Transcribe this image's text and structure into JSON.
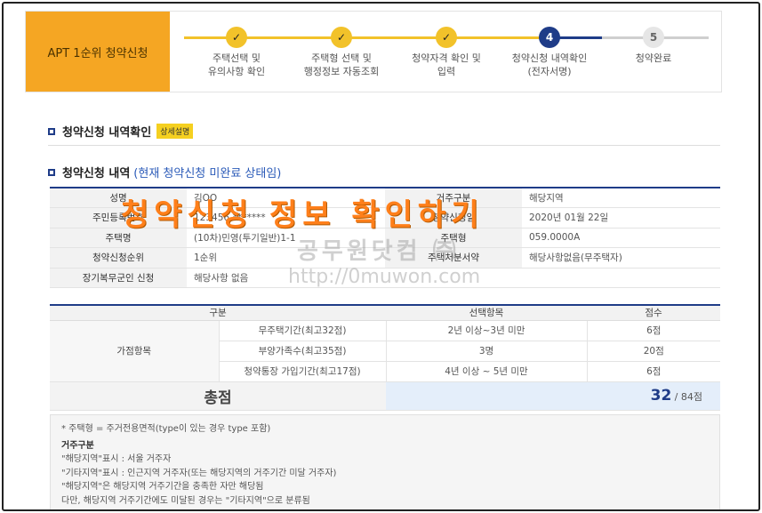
{
  "stepper": {
    "title": "APT 1순위 청약신청",
    "steps": [
      {
        "marker": "✓",
        "label": "주택선택 및\n유의사항 확인"
      },
      {
        "marker": "✓",
        "label": "주택형 선택 및\n행정정보 자동조회"
      },
      {
        "marker": "✓",
        "label": "청약자격 확인 및\n입력"
      },
      {
        "marker": "4",
        "label": "청약신청 내역확인\n(전자서명)"
      },
      {
        "marker": "5",
        "label": "청약완료"
      }
    ]
  },
  "section1": {
    "title": "청약신청 내역확인",
    "badge": "상세설명"
  },
  "section2": {
    "title": "청약신청 내역",
    "note": "(현재 청약신청 미완료 상태임)"
  },
  "info": {
    "rows": [
      {
        "l1": "성명",
        "v1": "김OO",
        "l2": "거주구분",
        "v2": "해당지역"
      },
      {
        "l1": "주민등록번호",
        "v1": "123456-*******",
        "l2": "청약신청일",
        "v2": "2020년 01월 22일"
      },
      {
        "l1": "주택명",
        "v1": "(10차)민영(투기일반)1-1",
        "l2": "주택형",
        "v2": "059.0000A"
      },
      {
        "l1": "청약신청순위",
        "v1": "1순위",
        "l2": "주택처분서약",
        "v2": "해당사항없음(무주택자)"
      },
      {
        "l1": "장기복무군인 신청",
        "v1": "해당사항 없음",
        "l2": "",
        "v2": ""
      }
    ]
  },
  "overlay": {
    "title": "청약신청 정보 확인하기",
    "watermark_name": "공무원닷컴 ㈜",
    "watermark_url": "http://0muwon.com"
  },
  "score": {
    "headers": {
      "category": "구분",
      "selection": "선택항목",
      "points": "점수"
    },
    "group": "가점항목",
    "rows": [
      {
        "item": "무주택기간(최고32점)",
        "selection": "2년 이상~3년 미만",
        "points": "6점"
      },
      {
        "item": "부양가족수(최고35점)",
        "selection": "3명",
        "points": "20점"
      },
      {
        "item": "청약통장 가입기간(최고17점)",
        "selection": "4년 이상 ~ 5년 미만",
        "points": "6점"
      }
    ],
    "total_label": "총점",
    "total_value": "32",
    "total_max": "/ 84점"
  },
  "notes": {
    "line1": "* 주택형 = 주거전용면적(type이 있는 경우 type 포함)",
    "heading": "거주구분",
    "line2": "\"해당지역\"표시 : 서울 거주자",
    "line3": "\"기타지역\"표시 : 인근지역 거주자(또는 해당지역의 거주기간 미달 거주자)",
    "line4": "\"해당지역\"은 해당지역 거주기간을 충족한 자만 해당됨",
    "line5": "다만, 해당지역 거주기간에도 미달된 경우는 \"기타지역\"으로 분류됨"
  }
}
